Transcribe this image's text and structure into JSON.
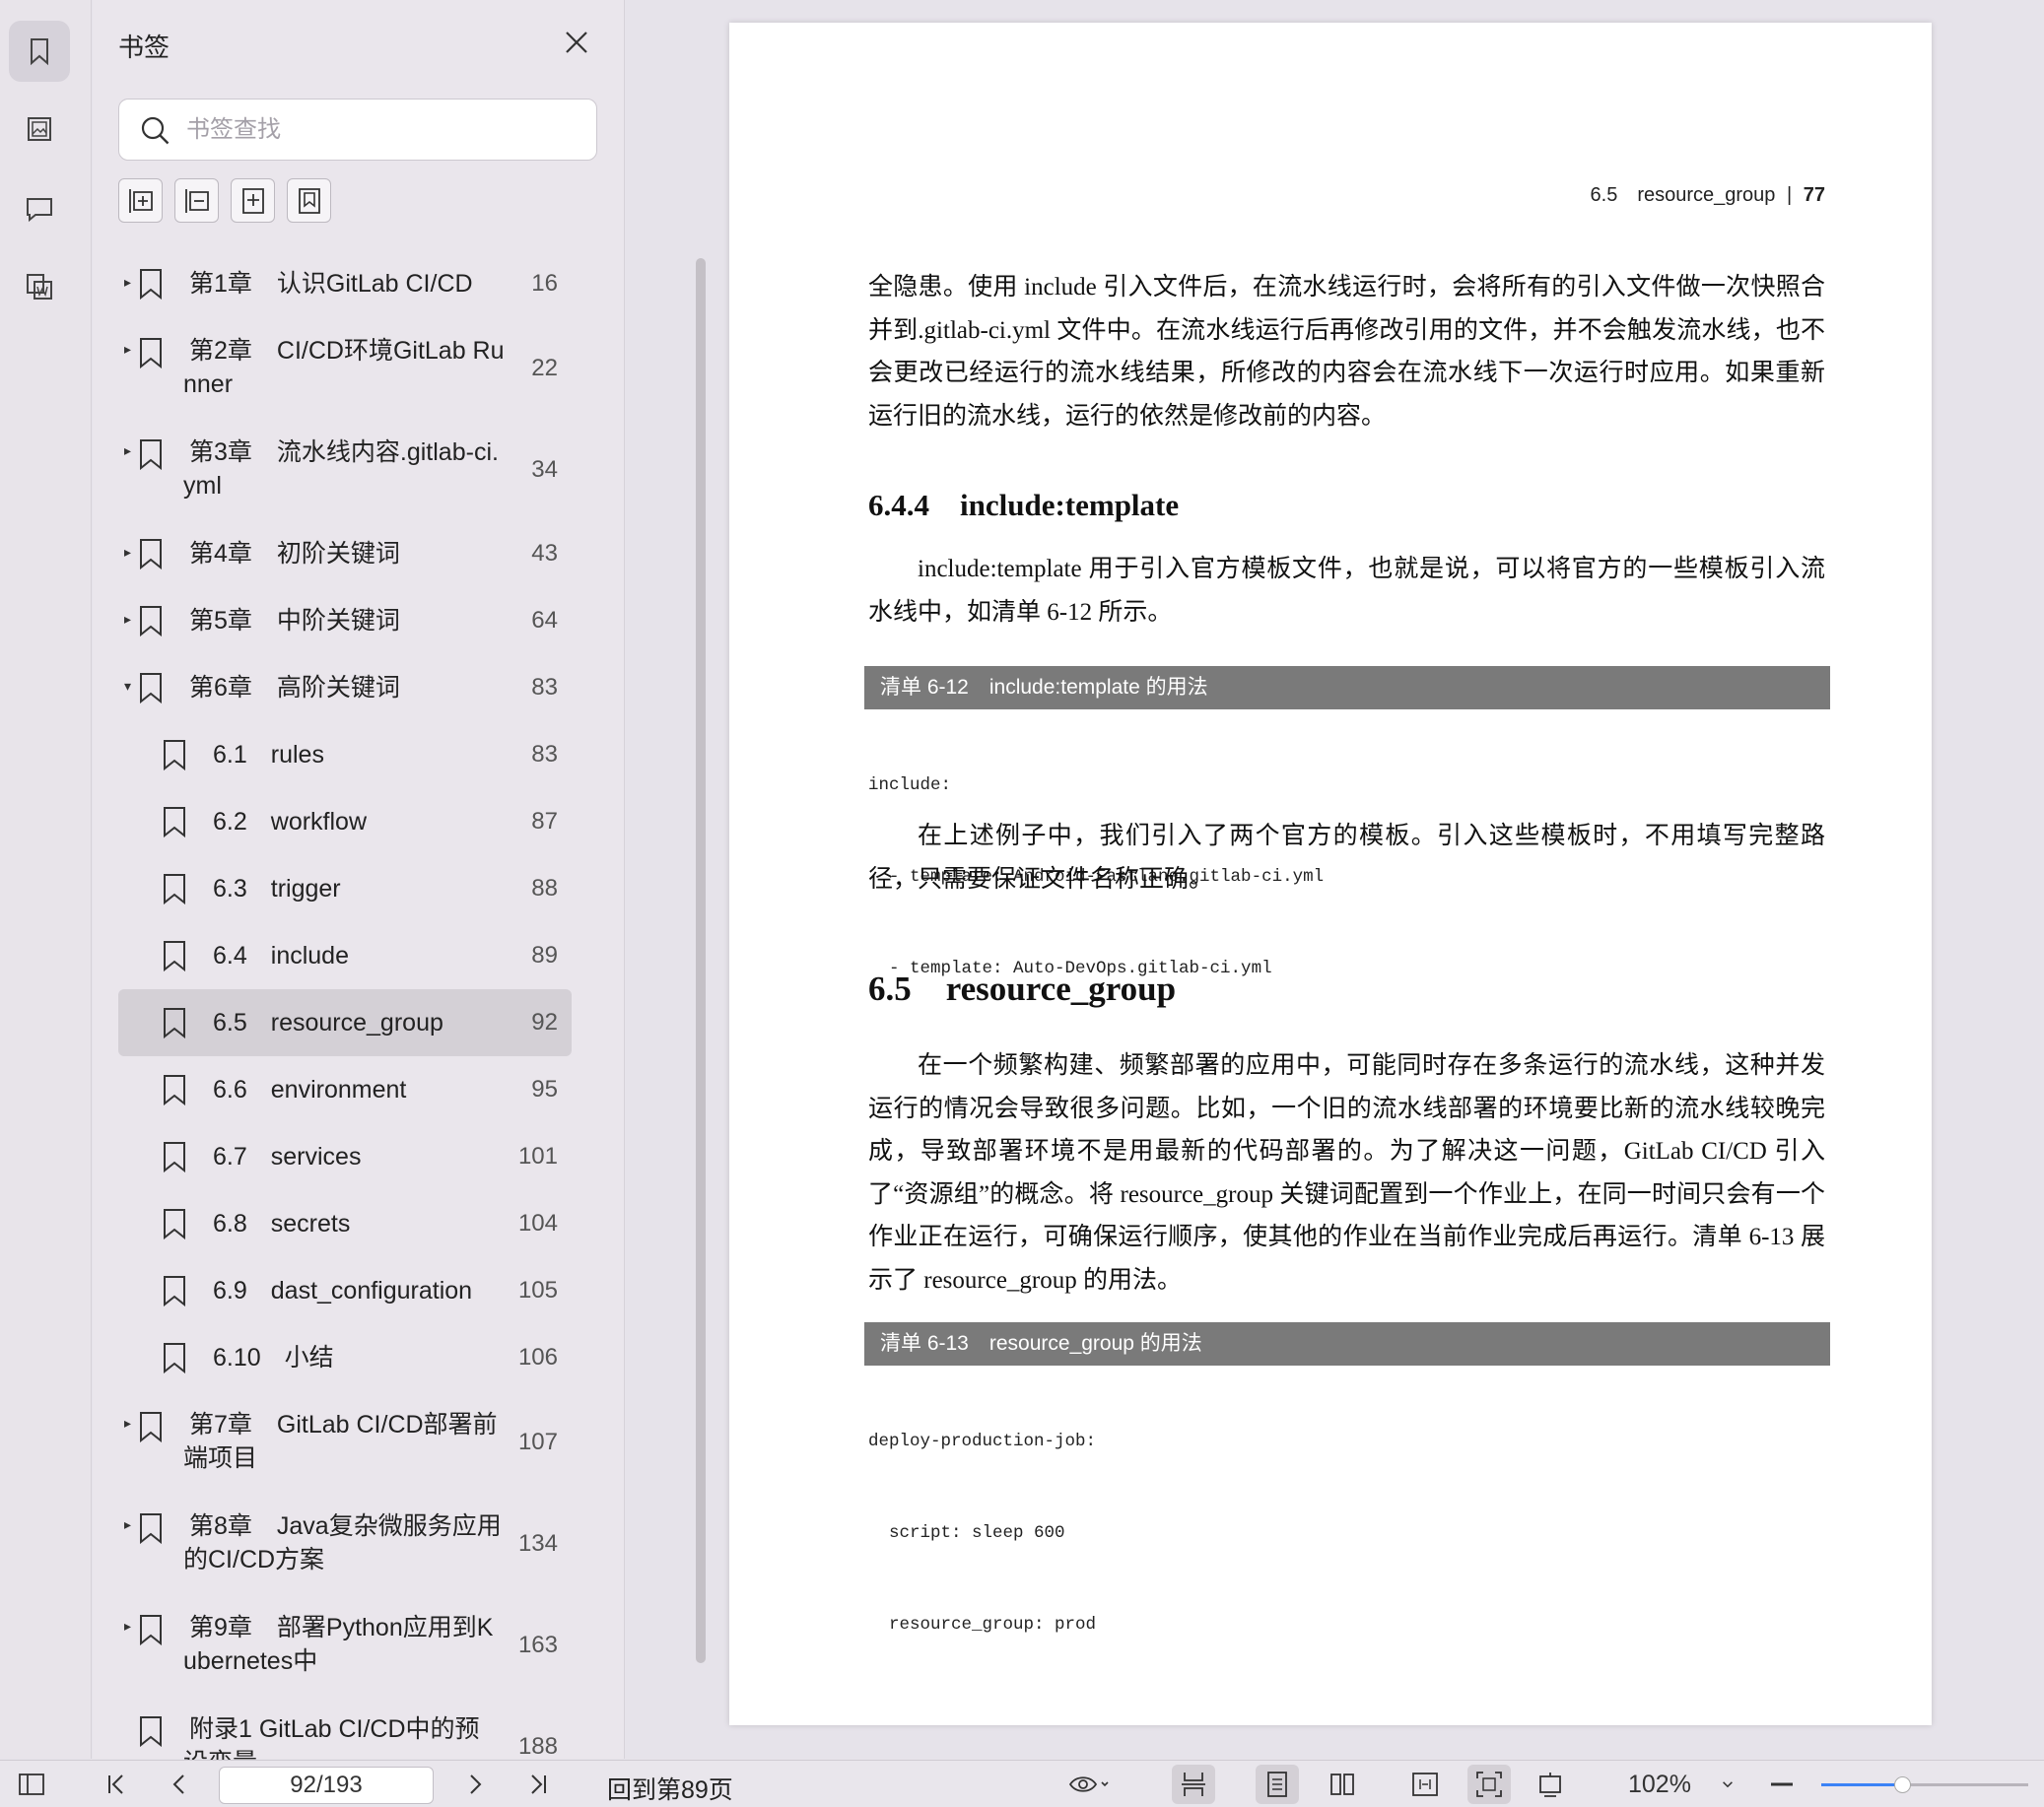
{
  "panel": {
    "title": "书签",
    "search_placeholder": "书签查找"
  },
  "bookmarks": [
    {
      "prefix": "第1章",
      "title": "认识GitLab CI/CD",
      "page": "16",
      "expand": "▸",
      "lines": [
        "第1章　认识GitLab CI/CD"
      ]
    },
    {
      "prefix": "第2章",
      "title": "CI/CD环境GitLab Runner",
      "page": "22",
      "expand": "▸",
      "lines": [
        "第2章　CI/CD环境GitLab Ru",
        "nner"
      ]
    },
    {
      "prefix": "第3章",
      "title": "流水线内容.gitlab-ci.yml",
      "page": "34",
      "expand": "▸",
      "lines": [
        "第3章　流水线内容.gitlab-ci.",
        "yml"
      ]
    },
    {
      "prefix": "第4章",
      "title": "初阶关键词",
      "page": "43",
      "expand": "▸",
      "lines": [
        "第4章　初阶关键词"
      ]
    },
    {
      "prefix": "第5章",
      "title": "中阶关键词",
      "page": "64",
      "expand": "▸",
      "lines": [
        "第5章　中阶关键词"
      ]
    },
    {
      "prefix": "第6章",
      "title": "高阶关键词",
      "page": "83",
      "expand": "▾",
      "lines": [
        "第6章　高阶关键词"
      ]
    },
    {
      "num": "6.1",
      "title": "rules",
      "page": "83",
      "child": true
    },
    {
      "num": "6.2",
      "title": "workflow",
      "page": "87",
      "child": true
    },
    {
      "num": "6.3",
      "title": "trigger",
      "page": "88",
      "child": true
    },
    {
      "num": "6.4",
      "title": "include",
      "page": "89",
      "child": true
    },
    {
      "num": "6.5",
      "title": "resource_group",
      "page": "92",
      "child": true,
      "selected": true
    },
    {
      "num": "6.6",
      "title": "environment",
      "page": "95",
      "child": true
    },
    {
      "num": "6.7",
      "title": "services",
      "page": "101",
      "child": true
    },
    {
      "num": "6.8",
      "title": "secrets",
      "page": "104",
      "child": true
    },
    {
      "num": "6.9",
      "title": "dast_configuration",
      "page": "105",
      "child": true
    },
    {
      "num": "6.10",
      "title": "小结",
      "page": "106",
      "child": true
    },
    {
      "prefix": "第7章",
      "title": "GitLab CI/CD部署前端项目",
      "page": "107",
      "expand": "▸",
      "lines": [
        "第7章　GitLab CI/CD部署前",
        "端项目"
      ]
    },
    {
      "prefix": "第8章",
      "title": "Java复杂微服务应用的CI/CD方案",
      "page": "134",
      "expand": "▸",
      "lines": [
        "第8章　Java复杂微服务应用",
        "的CI/CD方案"
      ]
    },
    {
      "prefix": "第9章",
      "title": "部署Python应用到Kubernetes中",
      "page": "163",
      "expand": "▸",
      "lines": [
        "第9章　部署Python应用到K",
        "ubernetes中"
      ]
    },
    {
      "prefix": "附录1",
      "title": "GitLab CI/CD中的预设变量",
      "page": "188",
      "expand": "",
      "lines": [
        "附录1 GitLab CI/CD中的预",
        "设变量"
      ]
    }
  ],
  "document": {
    "running_head_section": "6.5　resource_group",
    "running_head_page": "77",
    "para1": "全隐患。使用 include 引入文件后，在流水线运行时，会将所有的引入文件做一次快照合并到.gitlab-ci.yml 文件中。在流水线运行后再修改引用的文件，并不会触发流水线，也不会更改已经运行的流水线结果，所修改的内容会在流水线下一次运行时应用。如果重新运行旧的流水线，运行的依然是修改前的内容。",
    "h644": "6.4.4　include:template",
    "para2": "include:template 用于引入官方模板文件，也就是说，可以将官方的一些模板引入流水线中，如清单 6-12 所示。",
    "listing612": "清单 6-12　include:template 的用法",
    "code612": [
      "include:",
      "  - template: Android-Fastlane.gitlab-ci.yml",
      "  - template: Auto-DevOps.gitlab-ci.yml"
    ],
    "para3": "在上述例子中，我们引入了两个官方的模板。引入这些模板时，不用填写完整路径，只需要保证文件名称正确。",
    "h65": "6.5　resource_group",
    "para4": "在一个频繁构建、频繁部署的应用中，可能同时存在多条运行的流水线，这种并发运行的情况会导致很多问题。比如，一个旧的流水线部署的环境要比新的流水线较晚完成，导致部署环境不是用最新的代码部署的。为了解决这一问题，GitLab CI/CD 引入了“资源组”的概念。将 resource_group 关键词配置到一个作业上，在同一时间只会有一个作业正在运行，可确保运行顺序，使其他的作业在当前作业完成后再运行。清单 6-13 展示了 resource_group 的用法。",
    "listing613": "清单 6-13　resource_group 的用法",
    "code613": [
      "deploy-production-job:",
      "  script: sleep 600",
      "  resource_group: prod"
    ]
  },
  "bottombar": {
    "page_indicator": "92/193",
    "go_back": "回到第89页",
    "zoom": "102%",
    "zoom_slider_fraction": 0.39
  },
  "colors": {
    "accent": "#3b82f6",
    "listing_bar": "#7a7a7a"
  }
}
